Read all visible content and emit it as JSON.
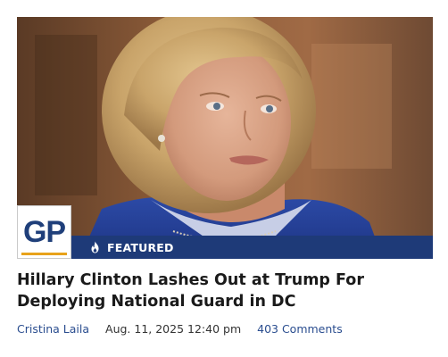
{
  "article": {
    "badge": "FEATURED",
    "headline": "Hillary Clinton Lashes Out at Trump For Deploying National Guard in DC",
    "author": "Cristina Laila",
    "date": "Aug. 11, 2025 12:40 pm",
    "comments": "403 Comments"
  },
  "logo": {
    "text": "GP"
  },
  "icons": {
    "badge_icon": "flame-icon"
  },
  "colors": {
    "brand_navy": "#1e3a78",
    "logo_blue": "#1f3f7a",
    "logo_accent": "#e8a21a",
    "link_blue": "#2a4d8f",
    "headline": "#1a1a1a"
  }
}
